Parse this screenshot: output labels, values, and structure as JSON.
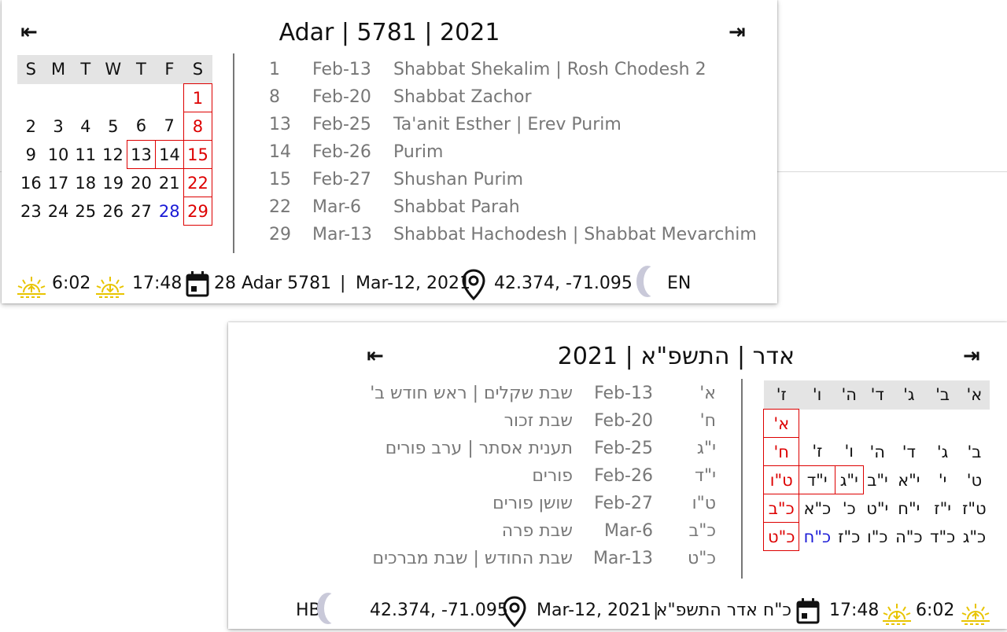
{
  "english": {
    "title": "Adar | 5781 | 2021",
    "nav_prev": "⇤",
    "nav_next": "⇥",
    "weekdays": [
      "S",
      "M",
      "T",
      "W",
      "T",
      "F",
      "S"
    ],
    "weeks": [
      [
        "",
        "",
        "",
        "",
        "",
        "",
        "1"
      ],
      [
        "2",
        "3",
        "4",
        "5",
        "6",
        "7",
        "8"
      ],
      [
        "9",
        "10",
        "11",
        "12",
        "13",
        "14",
        "15"
      ],
      [
        "16",
        "17",
        "18",
        "19",
        "20",
        "21",
        "22"
      ],
      [
        "23",
        "24",
        "25",
        "26",
        "27",
        "28",
        "29"
      ]
    ],
    "holidays": [
      {
        "day": "1",
        "date": "Feb-13",
        "name": "Shabbat Shekalim | Rosh Chodesh 2"
      },
      {
        "day": "8",
        "date": "Feb-20",
        "name": "Shabbat Zachor"
      },
      {
        "day": "13",
        "date": "Feb-25",
        "name": "Ta'anit Esther | Erev Purim"
      },
      {
        "day": "14",
        "date": "Feb-26",
        "name": "Purim"
      },
      {
        "day": "15",
        "date": "Feb-27",
        "name": "Shushan Purim"
      },
      {
        "day": "22",
        "date": "Mar-6",
        "name": "Shabbat Parah"
      },
      {
        "day": "29",
        "date": "Mar-13",
        "name": "Shabbat Hachodesh | Shabbat Mevarchim"
      }
    ],
    "footer": {
      "sunrise": "6:02",
      "sunset": "17:48",
      "hebrew_date": "28 Adar 5781",
      "separator": "|",
      "gregorian_date": "Mar-12, 2021",
      "location": "42.374, -71.095",
      "language": "EN"
    }
  },
  "hebrew": {
    "title": "אדר | התשפ\"א | 2021",
    "nav_prev": "⇤",
    "nav_next": "⇥",
    "weekdays": [
      "א'",
      "ב'",
      "ג'",
      "ד'",
      "ה'",
      "ו'",
      "ז'"
    ],
    "weeks": [
      [
        "",
        "",
        "",
        "",
        "",
        "",
        "א'"
      ],
      [
        "ב'",
        "ג'",
        "ד'",
        "ה'",
        "ו'",
        "ז'",
        "ח'"
      ],
      [
        "ט'",
        "י'",
        "י\"א",
        "י\"ב",
        "י\"ג",
        "י\"ד",
        "ט\"ו"
      ],
      [
        "ט\"ז",
        "י\"ז",
        "י\"ח",
        "י\"ט",
        "כ'",
        "כ\"א",
        "כ\"ב"
      ],
      [
        "כ\"ג",
        "כ\"ד",
        "כ\"ה",
        "כ\"ו",
        "כ\"ז",
        "כ\"ח",
        "כ\"ט"
      ]
    ],
    "holidays": [
      {
        "day": "א'",
        "date": "Feb-13",
        "name": "שבת שקלים | ראש חודש ב'"
      },
      {
        "day": "ח'",
        "date": "Feb-20",
        "name": "שבת זכור"
      },
      {
        "day": "י\"ג",
        "date": "Feb-25",
        "name": "תענית אסתר | ערב פורים"
      },
      {
        "day": "י\"ד",
        "date": "Feb-26",
        "name": "פורים"
      },
      {
        "day": "ט\"ו",
        "date": "Feb-27",
        "name": "שושן פורים"
      },
      {
        "day": "כ\"ב",
        "date": "Mar-6",
        "name": "שבת פרה"
      },
      {
        "day": "כ\"ט",
        "date": "Mar-13",
        "name": "שבת החודש | שבת מברכים"
      }
    ],
    "footer": {
      "sunrise": "6:02",
      "sunset": "17:48",
      "hebrew_date": "כ\"ח אדר התשפ\"א",
      "separator": "|",
      "gregorian_date": "Mar-12, 2021",
      "location": "42.374, -71.095",
      "language": "HB"
    }
  },
  "colors": {
    "shabbat_red": "#dd0000",
    "today_blue": "#1a1ad6",
    "sun_yellow": "#e8c400",
    "moon_gray": "#c9c9d9",
    "header_gray": "#e4e4e4"
  }
}
